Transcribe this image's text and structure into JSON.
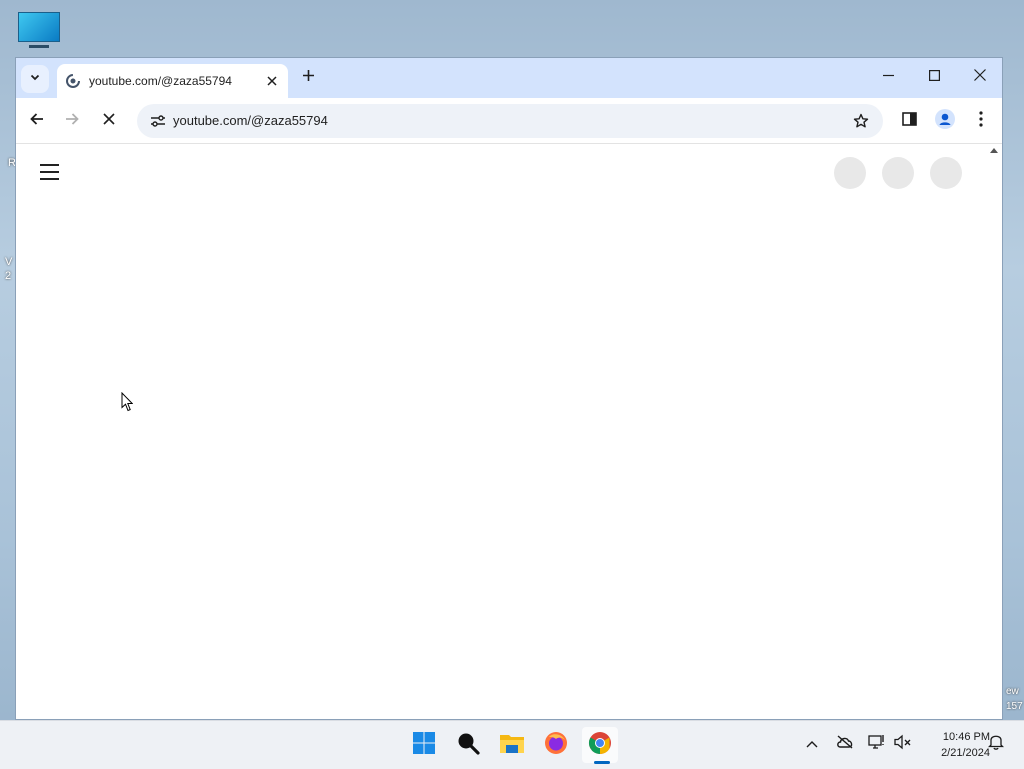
{
  "desktop": {
    "edge_text_1": "R",
    "edge_text_2": "V",
    "edge_text_3": "2",
    "edge_text_4": "ew",
    "edge_text_5": "157"
  },
  "browser": {
    "tab": {
      "title": "youtube.com/@zaza55794"
    },
    "address_bar": {
      "url": "youtube.com/@zaza55794"
    }
  },
  "taskbar": {
    "clock": {
      "time": "10:46 PM",
      "date": "2/21/2024"
    }
  },
  "colors": {
    "tab_strip": "#d3e3fd",
    "omnibox": "#eef2f8",
    "taskbar": "#eef1f5",
    "active_indicator": "#0067c0"
  },
  "icons": [
    "menu-icon",
    "close-icon",
    "plus-icon",
    "minimize-icon",
    "maximize-icon",
    "back-icon",
    "forward-icon",
    "stop-icon",
    "site-info-icon",
    "star-icon",
    "side-panel-icon",
    "profile-icon",
    "more-icon",
    "hamburger-icon",
    "windows-start-icon",
    "search-icon",
    "file-explorer-icon",
    "firefox-icon",
    "chrome-icon",
    "chevron-up-icon",
    "onedrive-icon",
    "network-icon",
    "volume-icon",
    "notification-icon"
  ]
}
